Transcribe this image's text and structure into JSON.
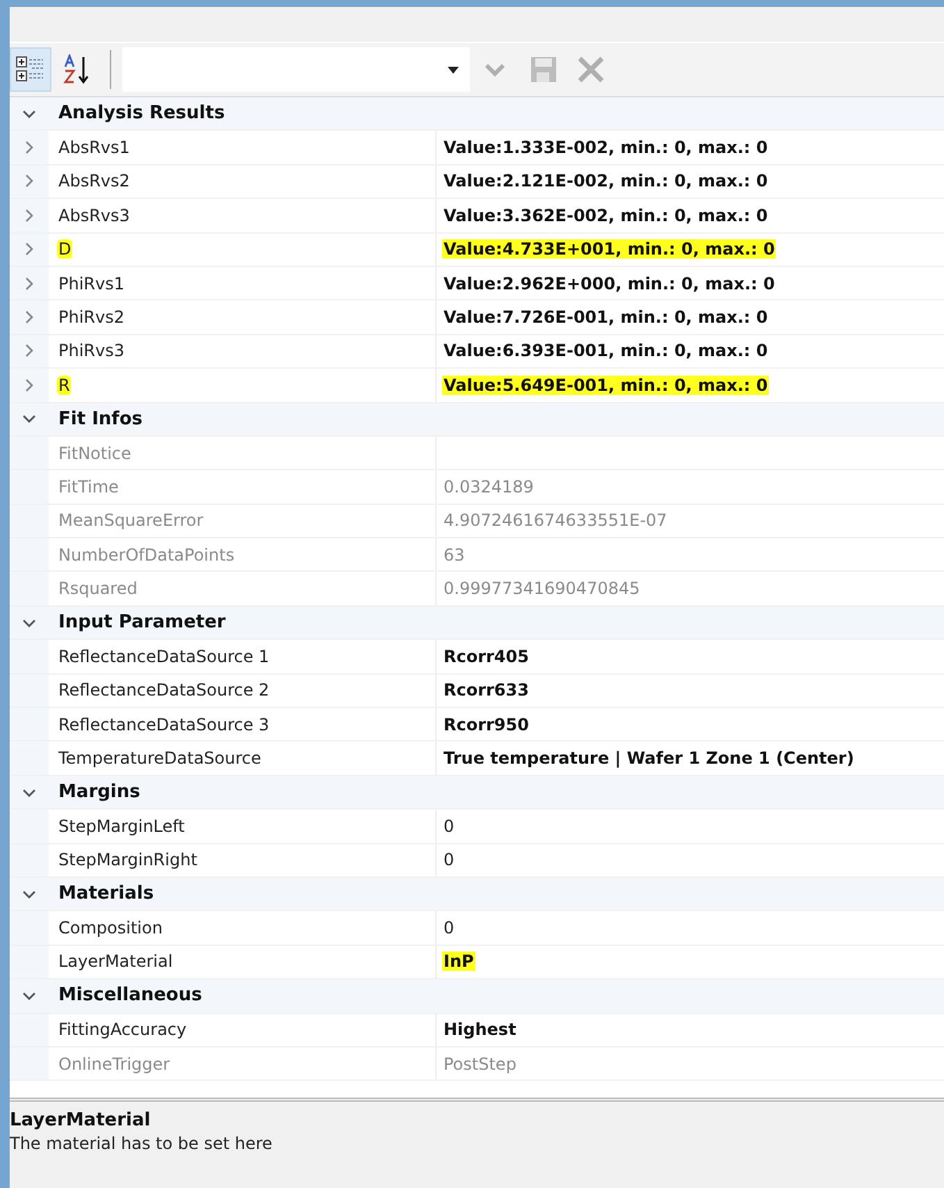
{
  "toolbar": {
    "view_buttons": [
      {
        "kind": "categorized",
        "selected": true
      },
      {
        "kind": "alphabetical",
        "selected": false
      }
    ],
    "actions": [
      {
        "kind": "apply",
        "disabled": true
      },
      {
        "kind": "save",
        "disabled": true
      },
      {
        "kind": "cancel",
        "disabled": true
      }
    ]
  },
  "categories": [
    {
      "name": "Analysis Results",
      "expanded": true,
      "properties": [
        {
          "name": "AbsRvs1",
          "value": "Value:1.333E-002, min.: 0, max.: 0",
          "bold": true,
          "readonly": false,
          "highlighted": false,
          "expandable": true
        },
        {
          "name": "AbsRvs2",
          "value": "Value:2.121E-002, min.: 0, max.: 0",
          "bold": true,
          "readonly": false,
          "highlighted": false,
          "expandable": true
        },
        {
          "name": "AbsRvs3",
          "value": "Value:3.362E-002, min.: 0, max.: 0",
          "bold": true,
          "readonly": false,
          "highlighted": false,
          "expandable": true
        },
        {
          "name": "D",
          "value": "Value:4.733E+001, min.: 0, max.: 0",
          "bold": true,
          "readonly": false,
          "highlighted": true,
          "expandable": true
        },
        {
          "name": "PhiRvs1",
          "value": "Value:2.962E+000, min.: 0, max.: 0",
          "bold": true,
          "readonly": false,
          "highlighted": false,
          "expandable": true
        },
        {
          "name": "PhiRvs2",
          "value": "Value:7.726E-001, min.: 0, max.: 0",
          "bold": true,
          "readonly": false,
          "highlighted": false,
          "expandable": true
        },
        {
          "name": "PhiRvs3",
          "value": "Value:6.393E-001, min.: 0, max.: 0",
          "bold": true,
          "readonly": false,
          "highlighted": false,
          "expandable": true
        },
        {
          "name": "R",
          "value": "Value:5.649E-001, min.: 0, max.: 0",
          "bold": true,
          "readonly": false,
          "highlighted": true,
          "expandable": true
        }
      ]
    },
    {
      "name": "Fit Infos",
      "expanded": true,
      "properties": [
        {
          "name": "FitNotice",
          "readonly": true,
          "highlighted": false,
          "expandable": false
        },
        {
          "name": "FitTime",
          "value": "0.0324189",
          "bold": false,
          "readonly": true,
          "highlighted": false,
          "expandable": false
        },
        {
          "name": "MeanSquareError",
          "value": "4.9072461674633551E-07",
          "bold": false,
          "readonly": true,
          "highlighted": false,
          "expandable": false
        },
        {
          "name": "NumberOfDataPoints",
          "value": "63",
          "bold": false,
          "readonly": true,
          "highlighted": false,
          "expandable": false
        },
        {
          "name": "Rsquared",
          "value": "0.99977341690470845",
          "bold": false,
          "readonly": true,
          "highlighted": false,
          "expandable": false
        }
      ]
    },
    {
      "name": "Input Parameter",
      "expanded": true,
      "properties": [
        {
          "name": "ReflectanceDataSource 1",
          "value": "Rcorr405",
          "bold": true,
          "readonly": false,
          "highlighted": false,
          "expandable": false
        },
        {
          "name": "ReflectanceDataSource 2",
          "value": "Rcorr633",
          "bold": true,
          "readonly": false,
          "highlighted": false,
          "expandable": false
        },
        {
          "name": "ReflectanceDataSource 3",
          "value": "Rcorr950",
          "bold": true,
          "readonly": false,
          "highlighted": false,
          "expandable": false
        },
        {
          "name": "TemperatureDataSource",
          "value": "True temperature | Wafer 1 Zone 1 (Center)",
          "bold": true,
          "readonly": false,
          "highlighted": false,
          "expandable": false
        }
      ]
    },
    {
      "name": "Margins",
      "expanded": true,
      "properties": [
        {
          "name": "StepMarginLeft",
          "value": "0",
          "bold": false,
          "readonly": false,
          "highlighted": false,
          "expandable": false
        },
        {
          "name": "StepMarginRight",
          "value": "0",
          "bold": false,
          "readonly": false,
          "highlighted": false,
          "expandable": false
        }
      ]
    },
    {
      "name": "Materials",
      "expanded": true,
      "properties": [
        {
          "name": "Composition",
          "value": "0",
          "bold": false,
          "readonly": false,
          "highlighted": false,
          "expandable": false
        },
        {
          "name": "LayerMaterial",
          "value": "InP",
          "bold": true,
          "readonly": false,
          "highlighted": false,
          "value_highlighted": true,
          "expandable": false
        }
      ]
    },
    {
      "name": "Miscellaneous",
      "expanded": true,
      "properties": [
        {
          "name": "FittingAccuracy",
          "value": "Highest",
          "bold": true,
          "readonly": false,
          "highlighted": false,
          "expandable": false
        },
        {
          "name": "OnlineTrigger",
          "value": "PostStep",
          "bold": false,
          "readonly": true,
          "highlighted": false,
          "expandable": false
        }
      ]
    }
  ],
  "description": {
    "title": "LayerMaterial",
    "text": "The material has to be set here"
  }
}
